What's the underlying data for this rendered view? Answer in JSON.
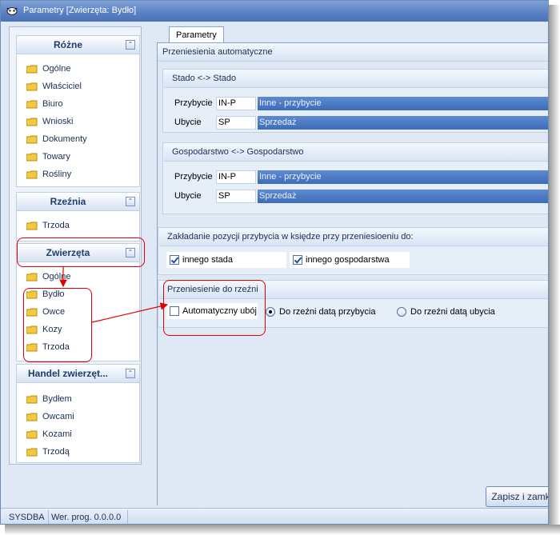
{
  "window": {
    "title": "Parametry [Zwierzęta: Bydło]"
  },
  "nav": {
    "groups": [
      {
        "label": "Różne",
        "items": [
          "Ogólne",
          "Właściciel",
          "Biuro",
          "Wnioski",
          "Dokumenty",
          "Towary",
          "Rośliny"
        ]
      },
      {
        "label": "Rzeźnia",
        "items": [
          "Trzoda"
        ]
      },
      {
        "label": "Zwierzęta",
        "items": [
          "Ogólne",
          "Bydło",
          "Owce",
          "Kozy",
          "Trzoda"
        ]
      },
      {
        "label": "Handel zwierzęt...",
        "items": [
          "Bydłem",
          "Owcami",
          "Kozami",
          "Trzodą"
        ]
      }
    ]
  },
  "tab": {
    "label": "Parametry"
  },
  "auto": {
    "title": "Przeniesienia automatyczne",
    "stado": {
      "title": "Stado <-> Stado",
      "przybycie_label": "Przybycie",
      "przybycie_code": "IN-P",
      "przybycie_desc": "Inne - przybycie",
      "ubycie_label": "Ubycie",
      "ubycie_code": "SP",
      "ubycie_desc": "Sprzedaż"
    },
    "gosp": {
      "title": "Gospodarstwo <-> Gospodarstwo",
      "przybycie_label": "Przybycie",
      "przybycie_code": "IN-P",
      "przybycie_desc": "Inne - przybycie",
      "ubycie_label": "Ubycie",
      "ubycie_code": "SP",
      "ubycie_desc": "Sprzedaż"
    }
  },
  "zakladanie": {
    "title": "Zakładanie pozycji przybycia w księdze przy przeniesioeniu do:",
    "opt1": "innego stada",
    "opt2": "innego gospodarstwa"
  },
  "rzeznia": {
    "title": "Przeniesienie do rzeźni",
    "auto_uboj": "Automatyczny ubój",
    "radio1": "Do rzeźni datą przybycia",
    "radio2": "Do rzeźni datą ubycia"
  },
  "buttons": {
    "save": "Zapisz i zamknij"
  },
  "status": {
    "user": "SYSDBA",
    "version": "Wer. prog. 0.0.0.0"
  },
  "colors": {
    "annotation": "#e00000",
    "selection": "#3e6cb8"
  }
}
